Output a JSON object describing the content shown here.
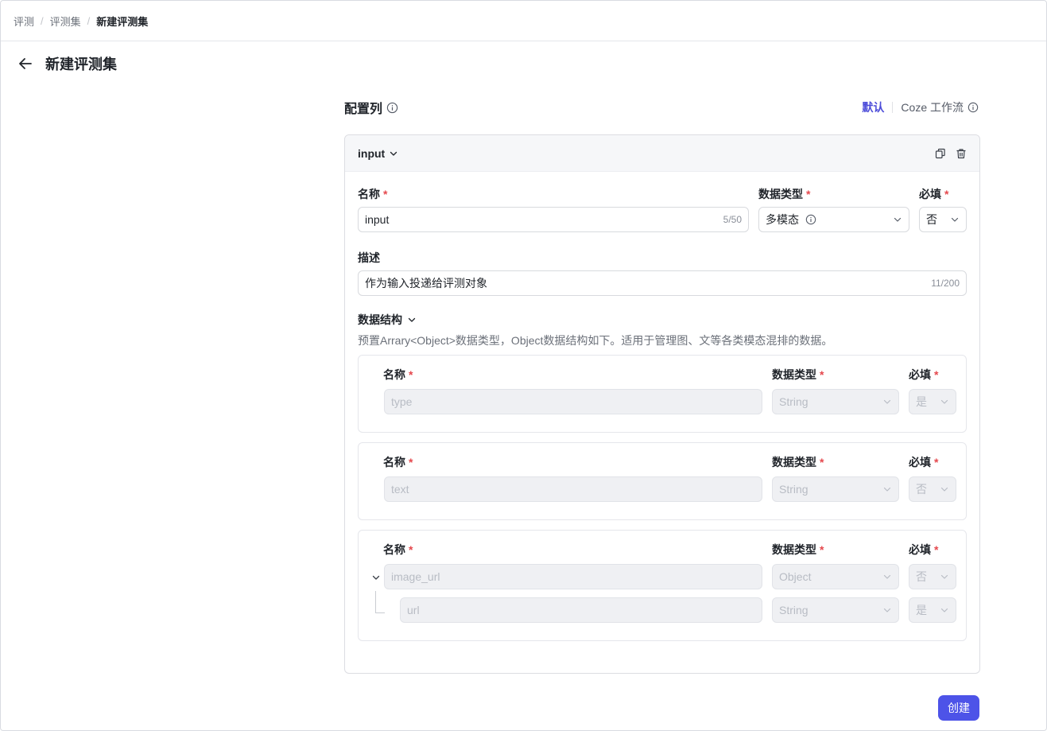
{
  "breadcrumb": [
    "评测",
    "评测集",
    "新建评测集"
  ],
  "page": {
    "title": "新建评测集"
  },
  "section": {
    "title": "配置列"
  },
  "mode": {
    "default_label": "默认",
    "coze_label": "Coze 工作流"
  },
  "column": {
    "name": "input",
    "name_label": "名称",
    "name_value": "input",
    "name_count": "5/50",
    "type_label": "数据类型",
    "type_value": "多模态",
    "required_label": "必填",
    "required_value": "否",
    "desc_label": "描述",
    "desc_value": "作为输入投递给评测对象",
    "desc_count": "11/200",
    "struct_label": "数据结构",
    "struct_hint": "预置Arrary<Object>数据类型，Object数据结构如下。适用于管理图、文等各类模态混排的数据。"
  },
  "fields": [
    {
      "name_label": "名称",
      "type_label": "数据类型",
      "required_label": "必填",
      "name": "type",
      "type": "String",
      "required": "是"
    },
    {
      "name_label": "名称",
      "type_label": "数据类型",
      "required_label": "必填",
      "name": "text",
      "type": "String",
      "required": "否"
    },
    {
      "name_label": "名称",
      "type_label": "数据类型",
      "required_label": "必填",
      "name": "image_url",
      "type": "Object",
      "required": "否",
      "child": {
        "name": "url",
        "type": "String",
        "required": "是"
      }
    }
  ],
  "actions": {
    "create": "创建"
  }
}
